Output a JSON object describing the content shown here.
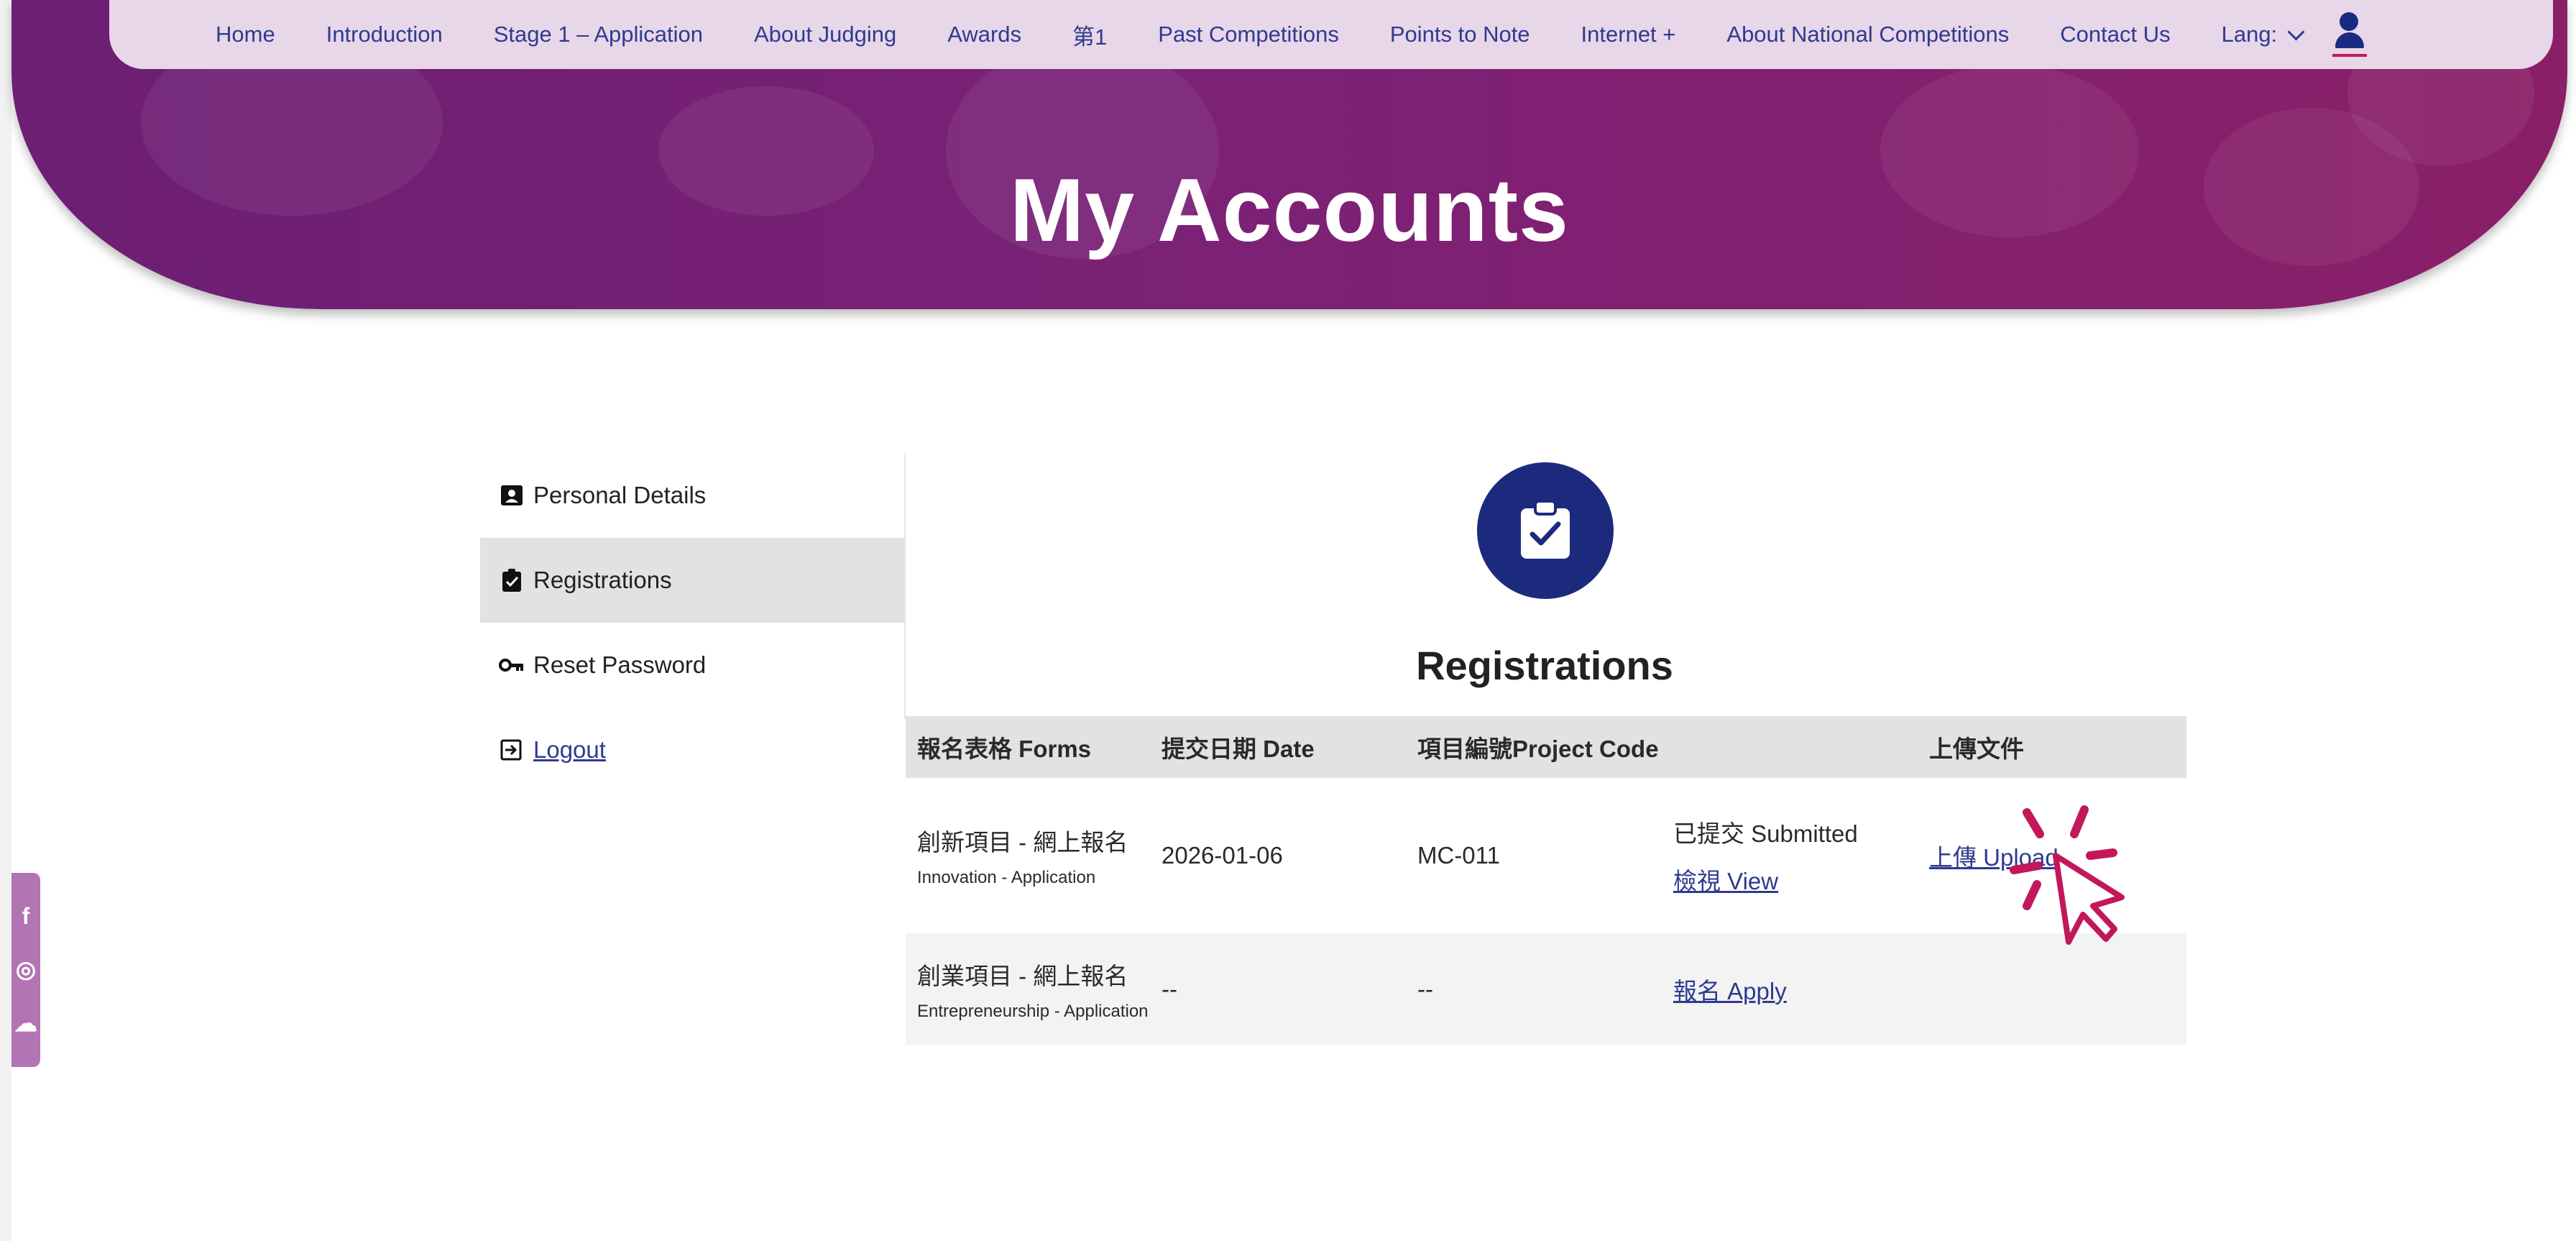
{
  "nav": {
    "items": [
      "Home",
      "Introduction",
      "Stage 1 – Application",
      "About Judging",
      "Awards",
      "第1",
      "Past Competitions",
      "Points to Note",
      "Internet +",
      "About National Competitions",
      "Contact Us"
    ],
    "lang_label": "Lang:"
  },
  "hero": {
    "title": "My Accounts"
  },
  "sidebar": {
    "items": [
      {
        "label": "Personal Details",
        "icon": "id-card-icon"
      },
      {
        "label": "Registrations",
        "icon": "clipboard-check-icon"
      },
      {
        "label": "Reset Password",
        "icon": "key-icon"
      },
      {
        "label": "Logout",
        "icon": "logout-icon"
      }
    ]
  },
  "main": {
    "title": "Registrations",
    "table": {
      "headers": [
        "報名表格 Forms",
        "提交日期 Date",
        "項目編號Project Code",
        "",
        "上傳文件"
      ],
      "rows": [
        {
          "form_zh": "創新項目 - 網上報名",
          "form_en": "Innovation - Application",
          "date": "2026-01-06",
          "code": "MC-011",
          "status": "已提交 Submitted",
          "action": "檢視 View",
          "upload": "上傳 Upload"
        },
        {
          "form_zh": "創業項目 - 網上報名",
          "form_en": "Entrepreneurship - Application",
          "date": "--",
          "code": "--",
          "status": "",
          "action": "報名 Apply",
          "upload": ""
        }
      ]
    }
  },
  "social": [
    "facebook-icon",
    "instagram-icon",
    "wechat-icon"
  ],
  "colors": {
    "hero": "#7b2176",
    "nav_bg": "#e8d6e9",
    "link": "#2e3b8f",
    "accent": "#c2185b",
    "icon_circle": "#1c2a7e"
  }
}
